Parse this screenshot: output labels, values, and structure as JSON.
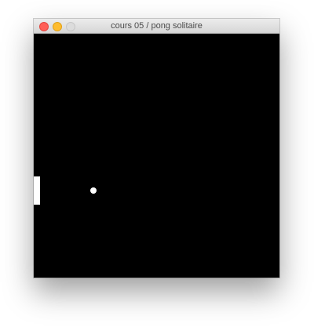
{
  "window": {
    "title": "cours 05 / pong solitaire",
    "controls": {
      "close_color": "#ff5f57",
      "minimize_color": "#febc2e",
      "zoom_color": "#dcdcdc"
    }
  },
  "game": {
    "background_color": "#000000",
    "paddle_color": "#ffffff",
    "ball_color": "#ffffff"
  }
}
